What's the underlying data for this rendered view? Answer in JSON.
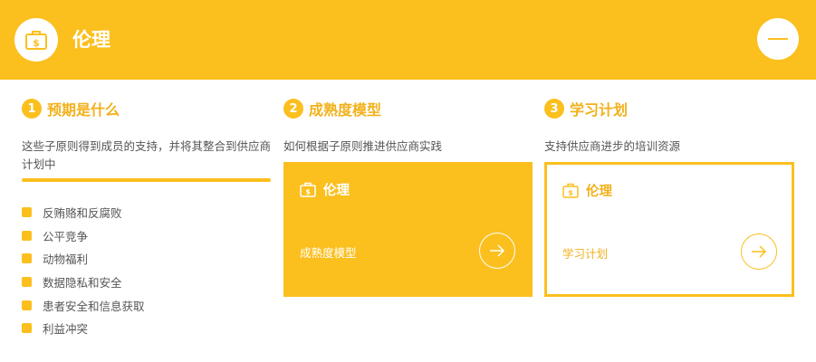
{
  "header": {
    "title": "伦理",
    "icon": "money-bag-icon",
    "collapse_icon": "minus-icon",
    "background_color": "#FBBF1E"
  },
  "columns": [
    {
      "number": "1",
      "title": "预期是什么",
      "description": "这些子原则得到成员的支持，并将其整合到供应商计划中",
      "items": [
        "反贿赂和反腐败",
        "公平竞争",
        "动物福利",
        "数据隐私和安全",
        "患者安全和信息获取",
        "利益冲突"
      ]
    },
    {
      "number": "2",
      "title": "成熟度模型",
      "description": "如何根据子原则推进供应商实践",
      "card": {
        "label": "伦理",
        "link_text": "成熟度模型",
        "icon": "money-bag-icon",
        "arrow_icon": "arrow-right-icon"
      }
    },
    {
      "number": "3",
      "title": "学习计划",
      "description": "支持供应商进步的培训资源",
      "card": {
        "label": "伦理",
        "link_text": "学习计划",
        "icon": "money-bag-icon",
        "arrow_icon": "arrow-right-icon"
      }
    }
  ],
  "colors": {
    "accent": "#FBBF1E",
    "accent_text": "#F2B11B",
    "body_text": "#555555"
  }
}
